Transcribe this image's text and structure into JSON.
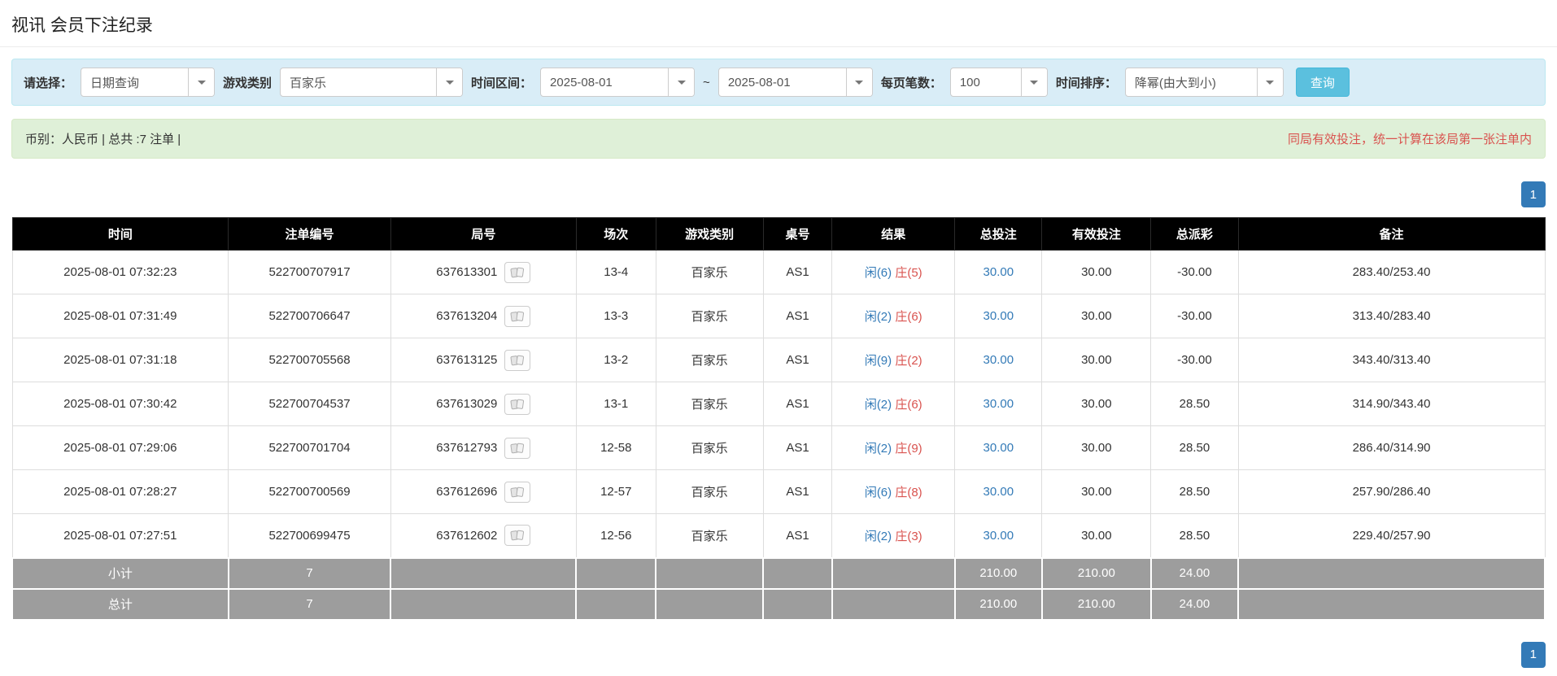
{
  "page_title": "视讯 会员下注纪录",
  "filters": {
    "query_type_label": "请选择：",
    "query_type_value": "日期查询",
    "game_type_label": "游戏类别",
    "game_type_value": "百家乐",
    "time_range_label": "时间区间：",
    "date_from": "2025-08-01",
    "date_separator": "~",
    "date_to": "2025-08-01",
    "page_size_label": "每页笔数：",
    "page_size_value": "100",
    "sort_label": "时间排序：",
    "sort_value": "降幂(由大到小)",
    "search_button_label": "查询"
  },
  "summary": {
    "left_text": "币别：人民币 | 总共 :7 注单 |",
    "right_notice": "同局有效投注，统一计算在该局第一张注单内"
  },
  "pagination": {
    "current_page": "1"
  },
  "table": {
    "headers": {
      "time": "时间",
      "bet_id": "注单编号",
      "round": "局号",
      "session": "场次",
      "game": "游戏类别",
      "table_no": "桌号",
      "result": "结果",
      "total_bet": "总投注",
      "valid_bet": "有效投注",
      "payout": "总派彩",
      "note": "备注"
    },
    "rows": [
      {
        "time": "2025-08-01 07:32:23",
        "bet_id": "522700707917",
        "round": "637613301",
        "session": "13-4",
        "game": "百家乐",
        "table_no": "AS1",
        "player": "闲(6)",
        "banker": "庄(5)",
        "total_bet": "30.00",
        "valid_bet": "30.00",
        "payout": "-30.00",
        "note": "283.40/253.40"
      },
      {
        "time": "2025-08-01 07:31:49",
        "bet_id": "522700706647",
        "round": "637613204",
        "session": "13-3",
        "game": "百家乐",
        "table_no": "AS1",
        "player": "闲(2)",
        "banker": "庄(6)",
        "total_bet": "30.00",
        "valid_bet": "30.00",
        "payout": "-30.00",
        "note": "313.40/283.40"
      },
      {
        "time": "2025-08-01 07:31:18",
        "bet_id": "522700705568",
        "round": "637613125",
        "session": "13-2",
        "game": "百家乐",
        "table_no": "AS1",
        "player": "闲(9)",
        "banker": "庄(2)",
        "total_bet": "30.00",
        "valid_bet": "30.00",
        "payout": "-30.00",
        "note": "343.40/313.40"
      },
      {
        "time": "2025-08-01 07:30:42",
        "bet_id": "522700704537",
        "round": "637613029",
        "session": "13-1",
        "game": "百家乐",
        "table_no": "AS1",
        "player": "闲(2)",
        "banker": "庄(6)",
        "total_bet": "30.00",
        "valid_bet": "30.00",
        "payout": "28.50",
        "note": "314.90/343.40"
      },
      {
        "time": "2025-08-01 07:29:06",
        "bet_id": "522700701704",
        "round": "637612793",
        "session": "12-58",
        "game": "百家乐",
        "table_no": "AS1",
        "player": "闲(2)",
        "banker": "庄(9)",
        "total_bet": "30.00",
        "valid_bet": "30.00",
        "payout": "28.50",
        "note": "286.40/314.90"
      },
      {
        "time": "2025-08-01 07:28:27",
        "bet_id": "522700700569",
        "round": "637612696",
        "session": "12-57",
        "game": "百家乐",
        "table_no": "AS1",
        "player": "闲(6)",
        "banker": "庄(8)",
        "total_bet": "30.00",
        "valid_bet": "30.00",
        "payout": "28.50",
        "note": "257.90/286.40"
      },
      {
        "time": "2025-08-01 07:27:51",
        "bet_id": "522700699475",
        "round": "637612602",
        "session": "12-56",
        "game": "百家乐",
        "table_no": "AS1",
        "player": "闲(2)",
        "banker": "庄(3)",
        "total_bet": "30.00",
        "valid_bet": "30.00",
        "payout": "28.50",
        "note": "229.40/257.90"
      }
    ],
    "footer": [
      {
        "label": "小计",
        "count": "7",
        "total_bet": "210.00",
        "valid_bet": "210.00",
        "payout": "24.00"
      },
      {
        "label": "总计",
        "count": "7",
        "total_bet": "210.00",
        "valid_bet": "210.00",
        "payout": "24.00"
      }
    ]
  }
}
